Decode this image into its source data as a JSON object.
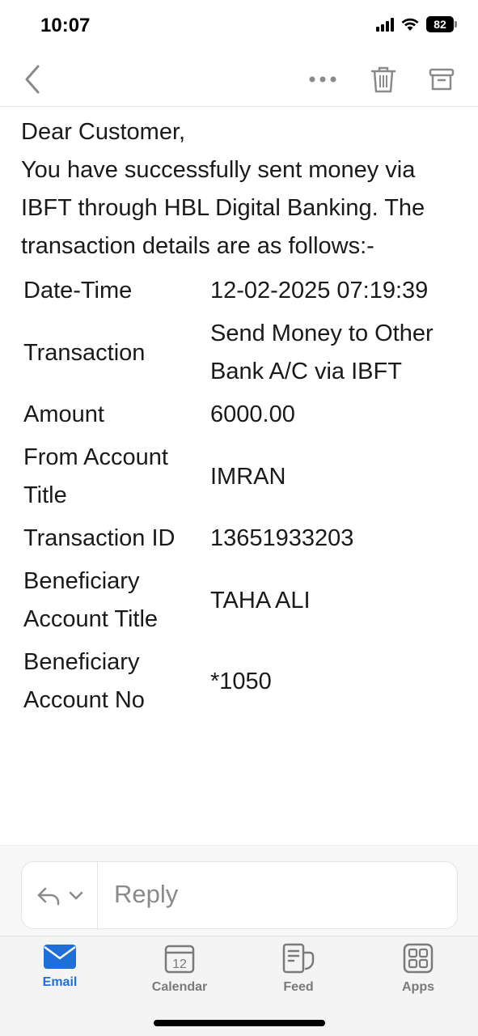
{
  "status_bar": {
    "time": "10:07",
    "battery": "82"
  },
  "nav": {
    "icons": [
      "chevron-left-icon",
      "more-icon",
      "trash-icon",
      "archive-icon"
    ]
  },
  "email": {
    "greeting": "Dear Customer,",
    "intro": "You have successfully sent money via IBFT through HBL Digital Banking. The transaction details are as follows:-",
    "details": [
      {
        "label": "Date-Time",
        "value": "12-02-2025 07:19:39"
      },
      {
        "label": "Transaction",
        "value": "Send Money to Other Bank A/C via IBFT"
      },
      {
        "label": "Amount",
        "value": "6000.00"
      },
      {
        "label": "From Account Title",
        "value": "IMRAN"
      },
      {
        "label": "Transaction ID",
        "value": "13651933203"
      },
      {
        "label": "Beneficiary Account Title",
        "value": "TAHA ALI"
      },
      {
        "label": "Beneficiary Account No",
        "value": "*1050"
      }
    ]
  },
  "reply": {
    "placeholder": "Reply"
  },
  "tabs": [
    {
      "label": "Email",
      "icon": "mail-icon",
      "active": true
    },
    {
      "label": "Calendar",
      "icon": "calendar-icon",
      "day": "12"
    },
    {
      "label": "Feed",
      "icon": "feed-icon"
    },
    {
      "label": "Apps",
      "icon": "apps-grid-icon"
    }
  ],
  "colors": {
    "accent": "#1f6fd8",
    "icon_gray": "#8a8a8a"
  }
}
